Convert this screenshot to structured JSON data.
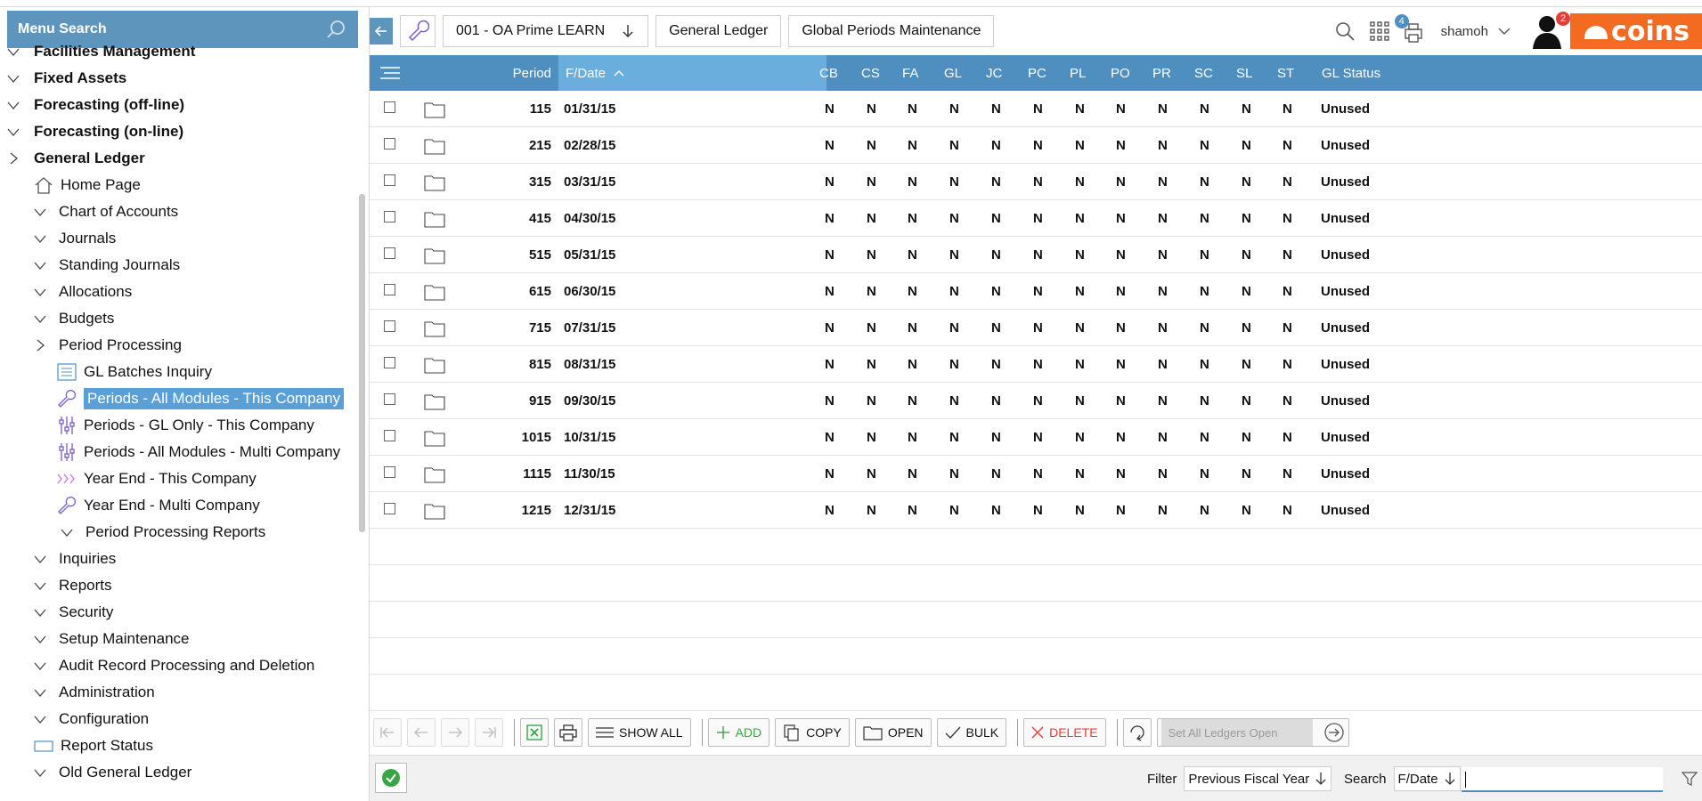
{
  "sidebar": {
    "menu_search_label": "Menu Search",
    "items": [
      {
        "label": "Facilities Management",
        "level": 0,
        "icon": "chevron-down-icon"
      },
      {
        "label": "Fixed Assets",
        "level": 0,
        "icon": "chevron-down-icon"
      },
      {
        "label": "Forecasting (off-line)",
        "level": 0,
        "icon": "chevron-down-icon"
      },
      {
        "label": "Forecasting (on-line)",
        "level": 0,
        "icon": "chevron-down-icon"
      },
      {
        "label": "General Ledger",
        "level": 0,
        "icon": "chevron-right-icon"
      },
      {
        "label": "Home Page",
        "level": 1,
        "icon": "home-icon"
      },
      {
        "label": "Chart of Accounts",
        "level": 1,
        "icon": "chevron-down-icon"
      },
      {
        "label": "Journals",
        "level": 1,
        "icon": "chevron-down-icon"
      },
      {
        "label": "Standing Journals",
        "level": 1,
        "icon": "chevron-down-icon"
      },
      {
        "label": "Allocations",
        "level": 1,
        "icon": "chevron-down-icon"
      },
      {
        "label": "Budgets",
        "level": 1,
        "icon": "chevron-down-icon"
      },
      {
        "label": "Period Processing",
        "level": 1,
        "icon": "chevron-right-icon"
      },
      {
        "label": "GL Batches Inquiry",
        "level": 2,
        "icon": "list-icon"
      },
      {
        "label": "Periods - All Modules - This Company",
        "level": 2,
        "icon": "wrench-icon",
        "selected": true
      },
      {
        "label": "Periods - GL Only - This Company",
        "level": 2,
        "icon": "sliders-icon"
      },
      {
        "label": "Periods - All Modules - Multi Company",
        "level": 2,
        "icon": "sliders-icon"
      },
      {
        "label": "Year End - This Company",
        "level": 2,
        "icon": "triple-chevron-icon"
      },
      {
        "label": "Year End - Multi Company",
        "level": 2,
        "icon": "wrench-icon"
      },
      {
        "label": "Period Processing Reports",
        "level": 2,
        "icon": "chevron-down-icon"
      },
      {
        "label": "Inquiries",
        "level": 1,
        "icon": "chevron-down-icon"
      },
      {
        "label": "Reports",
        "level": 1,
        "icon": "chevron-down-icon"
      },
      {
        "label": "Security",
        "level": 1,
        "icon": "chevron-down-icon"
      },
      {
        "label": "Setup Maintenance",
        "level": 1,
        "icon": "chevron-down-icon"
      },
      {
        "label": "Audit Record Processing and Deletion",
        "level": 1,
        "icon": "chevron-down-icon"
      },
      {
        "label": "Administration",
        "level": 1,
        "icon": "chevron-down-icon"
      },
      {
        "label": "Configuration",
        "level": 1,
        "icon": "chevron-down-icon"
      },
      {
        "label": "Report Status",
        "level": 1,
        "icon": "report-icon"
      },
      {
        "label": "Old General Ledger",
        "level": 1,
        "icon": "chevron-down-icon"
      }
    ]
  },
  "topbar": {
    "company": "001 - OA Prime LEARN",
    "crumb2": "General Ledger",
    "crumb3": "Global Periods Maintenance",
    "user": "shamoh",
    "print_badge": "4",
    "user_badge": "2",
    "logo_text": "coins"
  },
  "grid": {
    "columns": [
      "Period",
      "F/Date",
      "CB",
      "CS",
      "FA",
      "GL",
      "JC",
      "PC",
      "PL",
      "PO",
      "PR",
      "SC",
      "SL",
      "ST",
      "GL Status"
    ],
    "rows": [
      {
        "period": "115",
        "fdate": "01/31/15",
        "flags": [
          "N",
          "N",
          "N",
          "N",
          "N",
          "N",
          "N",
          "N",
          "N",
          "N",
          "N",
          "N"
        ],
        "status": "Unused"
      },
      {
        "period": "215",
        "fdate": "02/28/15",
        "flags": [
          "N",
          "N",
          "N",
          "N",
          "N",
          "N",
          "N",
          "N",
          "N",
          "N",
          "N",
          "N"
        ],
        "status": "Unused"
      },
      {
        "period": "315",
        "fdate": "03/31/15",
        "flags": [
          "N",
          "N",
          "N",
          "N",
          "N",
          "N",
          "N",
          "N",
          "N",
          "N",
          "N",
          "N"
        ],
        "status": "Unused"
      },
      {
        "period": "415",
        "fdate": "04/30/15",
        "flags": [
          "N",
          "N",
          "N",
          "N",
          "N",
          "N",
          "N",
          "N",
          "N",
          "N",
          "N",
          "N"
        ],
        "status": "Unused"
      },
      {
        "period": "515",
        "fdate": "05/31/15",
        "flags": [
          "N",
          "N",
          "N",
          "N",
          "N",
          "N",
          "N",
          "N",
          "N",
          "N",
          "N",
          "N"
        ],
        "status": "Unused"
      },
      {
        "period": "615",
        "fdate": "06/30/15",
        "flags": [
          "N",
          "N",
          "N",
          "N",
          "N",
          "N",
          "N",
          "N",
          "N",
          "N",
          "N",
          "N"
        ],
        "status": "Unused"
      },
      {
        "period": "715",
        "fdate": "07/31/15",
        "flags": [
          "N",
          "N",
          "N",
          "N",
          "N",
          "N",
          "N",
          "N",
          "N",
          "N",
          "N",
          "N"
        ],
        "status": "Unused"
      },
      {
        "period": "815",
        "fdate": "08/31/15",
        "flags": [
          "N",
          "N",
          "N",
          "N",
          "N",
          "N",
          "N",
          "N",
          "N",
          "N",
          "N",
          "N"
        ],
        "status": "Unused"
      },
      {
        "period": "915",
        "fdate": "09/30/15",
        "flags": [
          "N",
          "N",
          "N",
          "N",
          "N",
          "N",
          "N",
          "N",
          "N",
          "N",
          "N",
          "N"
        ],
        "status": "Unused"
      },
      {
        "period": "1015",
        "fdate": "10/31/15",
        "flags": [
          "N",
          "N",
          "N",
          "N",
          "N",
          "N",
          "N",
          "N",
          "N",
          "N",
          "N",
          "N"
        ],
        "status": "Unused"
      },
      {
        "period": "1115",
        "fdate": "11/30/15",
        "flags": [
          "N",
          "N",
          "N",
          "N",
          "N",
          "N",
          "N",
          "N",
          "N",
          "N",
          "N",
          "N"
        ],
        "status": "Unused"
      },
      {
        "period": "1215",
        "fdate": "12/31/15",
        "flags": [
          "N",
          "N",
          "N",
          "N",
          "N",
          "N",
          "N",
          "N",
          "N",
          "N",
          "N",
          "N"
        ],
        "status": "Unused"
      }
    ]
  },
  "toolbar": {
    "show_all": "SHOW ALL",
    "add": "ADD",
    "copy": "COPY",
    "open": "OPEN",
    "bulk": "BULK",
    "delete": "DELETE",
    "set_all_placeholder": "Set All Ledgers Open"
  },
  "footer": {
    "filter_label": "Filter",
    "filter_value": "Previous Fiscal Year",
    "search_label": "Search",
    "search_field": "F/Date",
    "search_value": ""
  },
  "colors": {
    "header_blue": "#4e8fbf",
    "sorted_col": "#6aaede",
    "menu_blue": "#5e95bd",
    "brand_orange": "#f26b21",
    "delete_red": "#e0403a",
    "add_green": "#3aa544"
  }
}
